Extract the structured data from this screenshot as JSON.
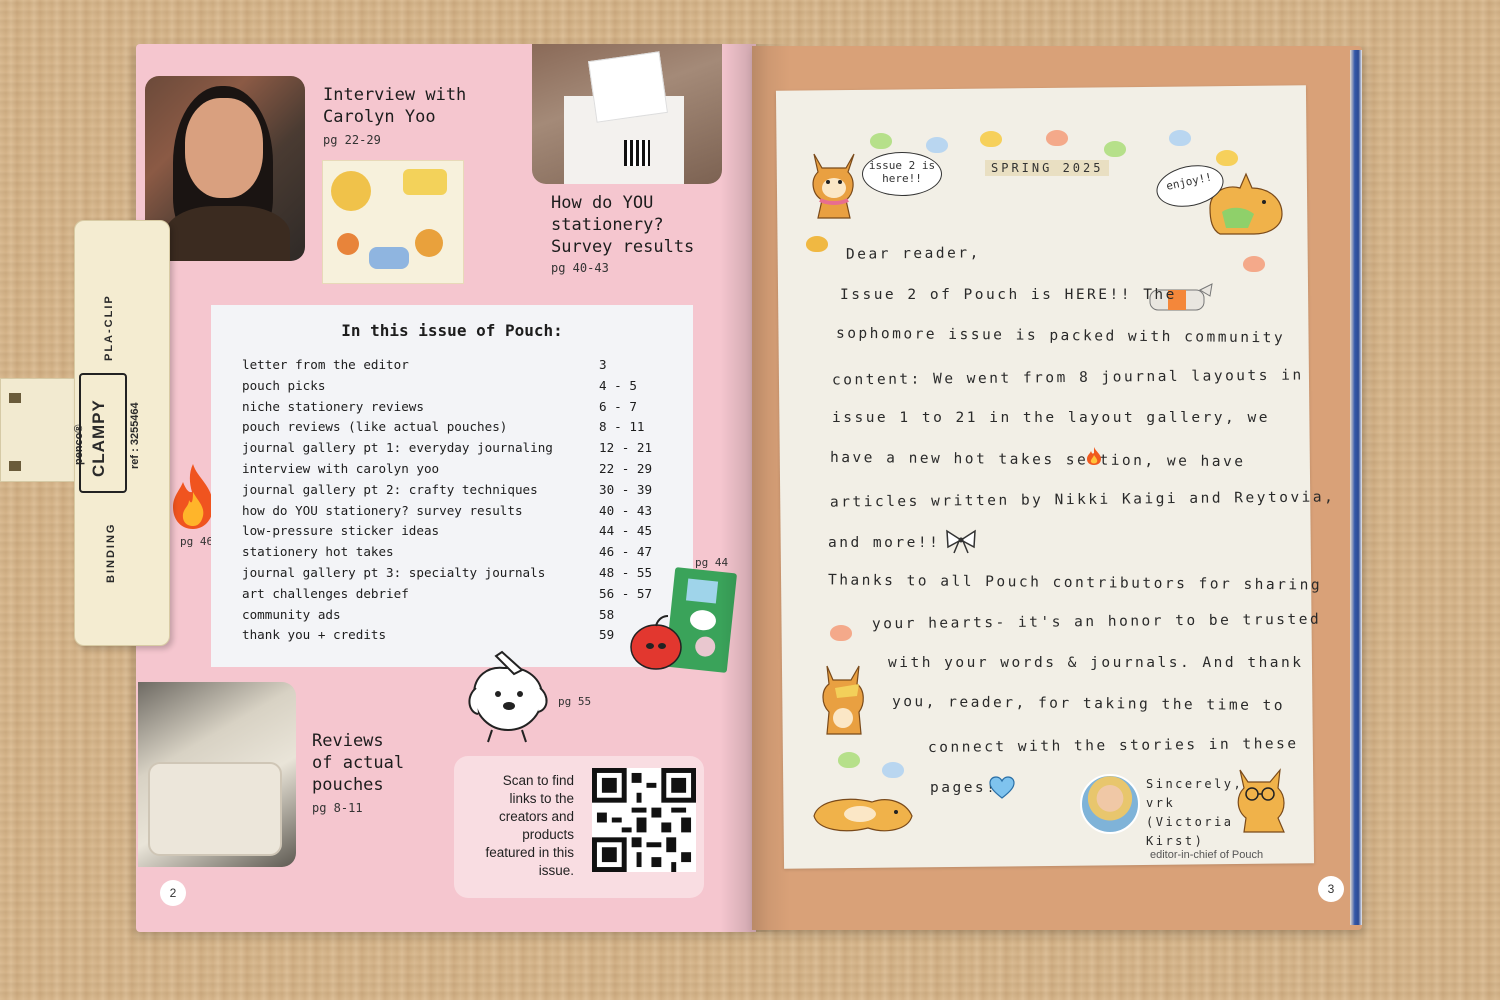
{
  "left_page": {
    "interview": {
      "title": "Interview with\nCarolyn Yoo",
      "pages": "pg 22-29"
    },
    "survey": {
      "title": "How do YOU\nstationery?\nSurvey results",
      "pages": "pg 40-43"
    },
    "reviews": {
      "title": "Reviews\nof actual\npouches",
      "pages": "pg 8-11"
    },
    "fire_label": "pg 46",
    "sticker_label": "pg 44",
    "dog_label": "pg 55",
    "toc": {
      "title": "In this issue of Pouch:",
      "items": [
        {
          "label": "letter from the editor",
          "pages": "3"
        },
        {
          "label": "pouch picks",
          "pages": "4 - 5"
        },
        {
          "label": "niche stationery reviews",
          "pages": "6 - 7"
        },
        {
          "label": "pouch reviews (like actual pouches)",
          "pages": "8 - 11"
        },
        {
          "label": "journal gallery pt 1: everyday journaling",
          "pages": "12 - 21"
        },
        {
          "label": "interview with carolyn yoo",
          "pages": "22 - 29"
        },
        {
          "label": "journal gallery pt 2: crafty techniques",
          "pages": "30 - 39"
        },
        {
          "label": "how do YOU stationery? survey results",
          "pages": "40 - 43"
        },
        {
          "label": "low-pressure sticker ideas",
          "pages": "44 - 45"
        },
        {
          "label": "stationery hot takes",
          "pages": "46 - 47"
        },
        {
          "label": "journal gallery pt 3: specialty journals",
          "pages": "48 - 55"
        },
        {
          "label": "art challenges debrief",
          "pages": "56 - 57"
        },
        {
          "label": "community ads",
          "pages": "58"
        },
        {
          "label": "thank you + credits",
          "pages": "59"
        }
      ]
    },
    "qr_text": "Scan to find\nlinks to the\ncreators and\nproducts\nfeatured in this\nissue.",
    "page_number": "2"
  },
  "right_page": {
    "season": "SPRING 2025",
    "bubble_left": "issue 2 is\nhere!!",
    "bubble_right": "enjoy!!",
    "letter_lines": [
      "Dear reader,",
      "Issue 2 of Pouch is HERE!!         The",
      "sophomore issue is packed with community",
      "content: We went from 8 journal layouts in",
      "issue 1 to 21 in the layout gallery, we",
      "have a new hot takes    section, we have",
      "articles written by Nikki Kaigi and Reytovia,",
      "and more!!",
      "Thanks to all Pouch contributors for sharing",
      "your hearts- it's an honor to be trusted",
      "with your words & journals. And thank",
      "you, reader, for taking the time to",
      "connect with the stories in these",
      "pages!"
    ],
    "signature": "Sincerely,\nvrk\n(Victoria\nKirst)",
    "editor_label": "editor-in-chief of Pouch",
    "page_number": "3"
  },
  "clip": {
    "brand": "penco®",
    "product": "CLAMPY",
    "ref": "ref : 3255464",
    "side_label": "PLA-CLIP",
    "binding": "BINDING"
  },
  "colors": {
    "left_page": "#f5c6cf",
    "right_page": "#d9a178",
    "letter_card": "#f2efe6",
    "toc_box": "#f3f4f7"
  }
}
